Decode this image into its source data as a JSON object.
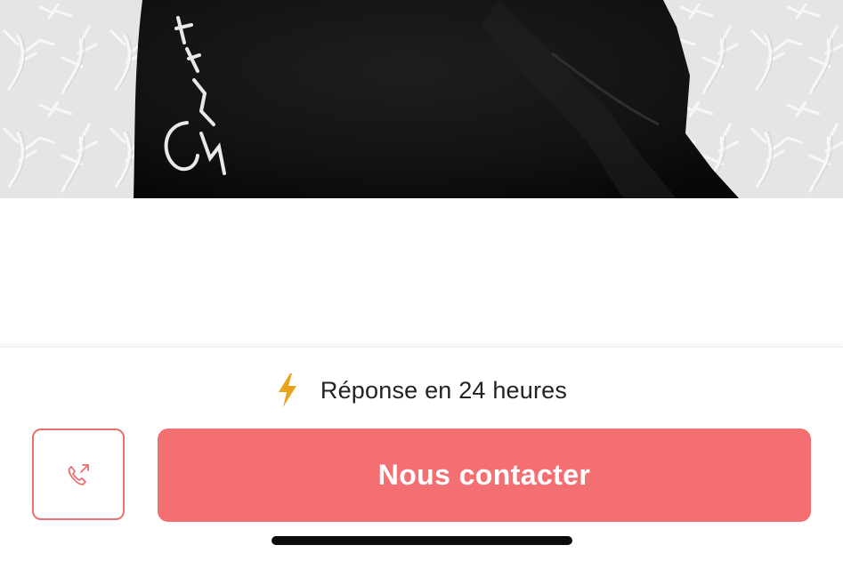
{
  "listing_photo": {
    "icon": "photo-black-bag-on-white-coral-pattern"
  },
  "response_info": {
    "icon": "lightning-bolt-icon",
    "icon_color": "#e8a21b",
    "text": "Réponse en 24 heures"
  },
  "actions": {
    "call_icon": "phone-outgoing-icon",
    "call_color": "#ea6f6f",
    "contact_label": "Nous contacter",
    "contact_color": "#f46f72"
  }
}
